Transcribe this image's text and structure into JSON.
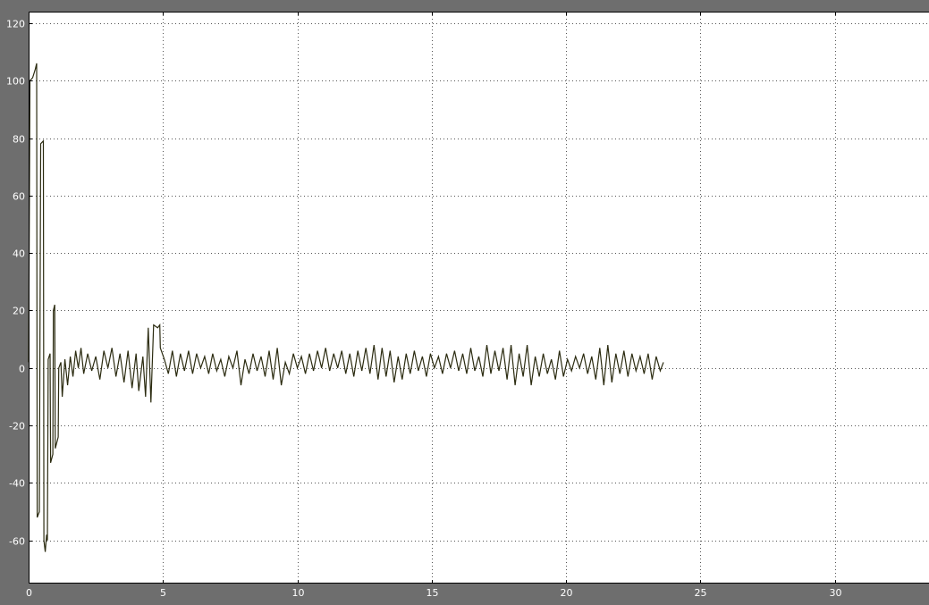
{
  "chart_data": {
    "type": "line",
    "title": "",
    "xlabel": "",
    "ylabel": "",
    "xlim": [
      0,
      33.5
    ],
    "ylim": [
      -75,
      124
    ],
    "x_ticks": [
      0,
      5,
      10,
      15,
      20,
      25,
      30
    ],
    "x_tick_labels": [
      "0",
      "5",
      "10",
      "15",
      "20",
      "25",
      "30"
    ],
    "y_ticks": [
      -60,
      -40,
      -20,
      0,
      20,
      40,
      60,
      80,
      100,
      120
    ],
    "y_tick_labels": [
      "-60",
      "-40",
      "-20",
      "0",
      "20",
      "40",
      "60",
      "80",
      "100",
      "120"
    ],
    "grid": true,
    "colors": {
      "background": "#6e6e6e",
      "plot_area": "#ffffff",
      "line": "#2b2b10",
      "grid": "#555555",
      "tick_text": "#ffffff"
    },
    "series": [
      {
        "values": [
          [
            0.0,
            2
          ],
          [
            0.05,
            100
          ],
          [
            0.15,
            101
          ],
          [
            0.25,
            104
          ],
          [
            0.3,
            106
          ],
          [
            0.32,
            -52
          ],
          [
            0.4,
            -50
          ],
          [
            0.45,
            78
          ],
          [
            0.55,
            79
          ],
          [
            0.57,
            -60
          ],
          [
            0.62,
            -64
          ],
          [
            0.67,
            -58
          ],
          [
            0.7,
            -60
          ],
          [
            0.73,
            3
          ],
          [
            0.8,
            5
          ],
          [
            0.82,
            -33
          ],
          [
            0.9,
            -30
          ],
          [
            0.92,
            20
          ],
          [
            0.97,
            22
          ],
          [
            0.99,
            -28
          ],
          [
            1.1,
            -24
          ],
          [
            1.12,
            0
          ],
          [
            1.2,
            2
          ],
          [
            1.25,
            -10
          ],
          [
            1.35,
            3
          ],
          [
            1.45,
            -6
          ],
          [
            1.55,
            4
          ],
          [
            1.65,
            -3
          ],
          [
            1.75,
            6
          ],
          [
            1.85,
            0
          ],
          [
            1.95,
            7
          ],
          [
            2.05,
            -2
          ],
          [
            2.2,
            5
          ],
          [
            2.35,
            -1
          ],
          [
            2.5,
            4
          ],
          [
            2.65,
            -4
          ],
          [
            2.8,
            6
          ],
          [
            2.95,
            0
          ],
          [
            3.1,
            7
          ],
          [
            3.25,
            -3
          ],
          [
            3.4,
            5
          ],
          [
            3.55,
            -5
          ],
          [
            3.7,
            6
          ],
          [
            3.85,
            -7
          ],
          [
            4.0,
            5
          ],
          [
            4.1,
            -8
          ],
          [
            4.25,
            4
          ],
          [
            4.35,
            -10
          ],
          [
            4.45,
            14
          ],
          [
            4.55,
            -12
          ],
          [
            4.65,
            15
          ],
          [
            4.8,
            14
          ],
          [
            4.88,
            15
          ],
          [
            4.9,
            7
          ],
          [
            5.05,
            3
          ],
          [
            5.2,
            -2
          ],
          [
            5.35,
            6
          ],
          [
            5.5,
            -3
          ],
          [
            5.65,
            5
          ],
          [
            5.8,
            -1
          ],
          [
            5.95,
            6
          ],
          [
            6.1,
            -2
          ],
          [
            6.25,
            5
          ],
          [
            6.4,
            0
          ],
          [
            6.55,
            4
          ],
          [
            6.7,
            -2
          ],
          [
            6.85,
            5
          ],
          [
            7.0,
            -1
          ],
          [
            7.15,
            3
          ],
          [
            7.3,
            -3
          ],
          [
            7.45,
            4
          ],
          [
            7.6,
            0
          ],
          [
            7.75,
            6
          ],
          [
            7.9,
            -6
          ],
          [
            8.05,
            3
          ],
          [
            8.2,
            -2
          ],
          [
            8.35,
            5
          ],
          [
            8.5,
            -1
          ],
          [
            8.65,
            4
          ],
          [
            8.8,
            -3
          ],
          [
            8.95,
            6
          ],
          [
            9.1,
            -4
          ],
          [
            9.25,
            7
          ],
          [
            9.4,
            -6
          ],
          [
            9.55,
            2
          ],
          [
            9.7,
            -2
          ],
          [
            9.85,
            5
          ],
          [
            10.0,
            0
          ],
          [
            10.15,
            4
          ],
          [
            10.3,
            -2
          ],
          [
            10.45,
            5
          ],
          [
            10.6,
            -1
          ],
          [
            10.75,
            6
          ],
          [
            10.9,
            0
          ],
          [
            11.05,
            7
          ],
          [
            11.2,
            -1
          ],
          [
            11.35,
            5
          ],
          [
            11.5,
            0
          ],
          [
            11.65,
            6
          ],
          [
            11.8,
            -2
          ],
          [
            11.95,
            5
          ],
          [
            12.1,
            -3
          ],
          [
            12.25,
            6
          ],
          [
            12.4,
            -1
          ],
          [
            12.55,
            7
          ],
          [
            12.7,
            -2
          ],
          [
            12.85,
            8
          ],
          [
            13.0,
            -4
          ],
          [
            13.15,
            7
          ],
          [
            13.3,
            -3
          ],
          [
            13.45,
            6
          ],
          [
            13.6,
            -5
          ],
          [
            13.75,
            4
          ],
          [
            13.9,
            -4
          ],
          [
            14.05,
            5
          ],
          [
            14.2,
            -2
          ],
          [
            14.35,
            6
          ],
          [
            14.5,
            -1
          ],
          [
            14.65,
            4
          ],
          [
            14.8,
            -3
          ],
          [
            14.95,
            5
          ],
          [
            15.1,
            0
          ],
          [
            15.25,
            4
          ],
          [
            15.4,
            -2
          ],
          [
            15.55,
            5
          ],
          [
            15.7,
            0
          ],
          [
            15.85,
            6
          ],
          [
            16.0,
            -1
          ],
          [
            16.15,
            5
          ],
          [
            16.3,
            -2
          ],
          [
            16.45,
            7
          ],
          [
            16.6,
            -1
          ],
          [
            16.75,
            4
          ],
          [
            16.9,
            -3
          ],
          [
            17.05,
            8
          ],
          [
            17.2,
            -2
          ],
          [
            17.35,
            6
          ],
          [
            17.5,
            -1
          ],
          [
            17.65,
            7
          ],
          [
            17.8,
            -4
          ],
          [
            17.95,
            8
          ],
          [
            18.1,
            -6
          ],
          [
            18.25,
            5
          ],
          [
            18.4,
            -3
          ],
          [
            18.55,
            8
          ],
          [
            18.7,
            -6
          ],
          [
            18.85,
            4
          ],
          [
            19.0,
            -3
          ],
          [
            19.15,
            5
          ],
          [
            19.3,
            -2
          ],
          [
            19.45,
            3
          ],
          [
            19.6,
            -4
          ],
          [
            19.75,
            6
          ],
          [
            19.9,
            -3
          ],
          [
            20.05,
            3
          ],
          [
            20.2,
            -1
          ],
          [
            20.35,
            4
          ],
          [
            20.5,
            0
          ],
          [
            20.65,
            5
          ],
          [
            20.8,
            -2
          ],
          [
            20.95,
            4
          ],
          [
            21.1,
            -4
          ],
          [
            21.25,
            7
          ],
          [
            21.4,
            -6
          ],
          [
            21.55,
            8
          ],
          [
            21.7,
            -5
          ],
          [
            21.85,
            5
          ],
          [
            22.0,
            -2
          ],
          [
            22.15,
            6
          ],
          [
            22.3,
            -3
          ],
          [
            22.45,
            5
          ],
          [
            22.6,
            -1
          ],
          [
            22.75,
            4
          ],
          [
            22.9,
            -2
          ],
          [
            23.05,
            5
          ],
          [
            23.2,
            -4
          ],
          [
            23.35,
            4
          ],
          [
            23.5,
            -1
          ],
          [
            23.62,
            2
          ]
        ]
      }
    ]
  }
}
